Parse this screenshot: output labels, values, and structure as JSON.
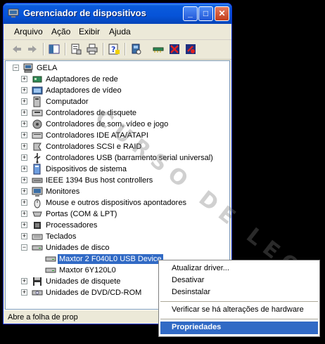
{
  "window": {
    "title": "Gerenciador de dispositivos",
    "controls": {
      "minimize": "_",
      "maximize": "□",
      "close": "✕"
    }
  },
  "menu": [
    "Arquivo",
    "Ação",
    "Exibir",
    "Ajuda"
  ],
  "toolbar_icons": [
    "back-icon",
    "forward-icon",
    "tree-view-icon",
    "properties-icon",
    "print-icon",
    "help-icon",
    "scan-hardware-icon",
    "update-driver-icon",
    "uninstall-icon",
    "disable-icon"
  ],
  "tree": {
    "root": "GELA",
    "categories": [
      {
        "label": "Adaptadores de rede",
        "icon": "network-adapter-icon"
      },
      {
        "label": "Adaptadores de vídeo",
        "icon": "display-adapter-icon"
      },
      {
        "label": "Computador",
        "icon": "computer-icon"
      },
      {
        "label": "Controladores de disquete",
        "icon": "floppy-controller-icon"
      },
      {
        "label": "Controladores de som, vídeo e jogo",
        "icon": "sound-icon"
      },
      {
        "label": "Controladores IDE ATA/ATAPI",
        "icon": "ide-controller-icon"
      },
      {
        "label": "Controladores SCSI e RAID",
        "icon": "scsi-icon"
      },
      {
        "label": "Controladores USB (barramento serial universal)",
        "icon": "usb-icon"
      },
      {
        "label": "Dispositivos de sistema",
        "icon": "system-devices-icon"
      },
      {
        "label": "IEEE 1394 Bus host controllers",
        "icon": "firewire-icon"
      },
      {
        "label": "Monitores",
        "icon": "monitor-icon"
      },
      {
        "label": "Mouse e outros dispositivos apontadores",
        "icon": "mouse-icon"
      },
      {
        "label": "Portas (COM & LPT)",
        "icon": "port-icon"
      },
      {
        "label": "Processadores",
        "icon": "processor-icon"
      },
      {
        "label": "Teclados",
        "icon": "keyboard-icon"
      },
      {
        "label": "Unidades de disco",
        "icon": "disk-drive-icon",
        "expanded": true,
        "children": [
          {
            "label": "Maxtor 2 F040L0 USB Device",
            "selected": true
          },
          {
            "label": "Maxtor 6Y120L0"
          }
        ]
      },
      {
        "label": "Unidades de disquete",
        "icon": "floppy-drive-icon"
      },
      {
        "label": "Unidades de DVD/CD-ROM",
        "icon": "cdrom-icon"
      }
    ]
  },
  "status": "Abre a folha de prop",
  "context_menu": {
    "items": [
      "Atualizar driver...",
      "Desativar",
      "Desinstalar"
    ],
    "scan": "Verificar se há alterações de hardware",
    "properties": "Propriedades"
  },
  "watermark": "CURSO DE LEO",
  "colors": {
    "selection": "#316ac5",
    "titlebar": "#0653d8"
  }
}
